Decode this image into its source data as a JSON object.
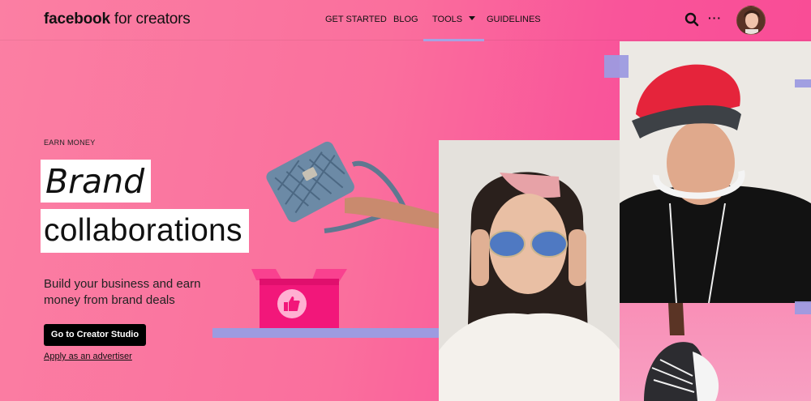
{
  "header": {
    "logo_bold": "facebook",
    "logo_rest": " for creators",
    "nav": [
      {
        "label": "GET STARTED"
      },
      {
        "label": "BLOG"
      },
      {
        "label": "TOOLS"
      },
      {
        "label": "GUIDELINES"
      }
    ],
    "more_label": "···"
  },
  "hero": {
    "eyebrow": "EARN MONEY",
    "title_line1": "Brand",
    "title_line2": "collaborations",
    "description": "Build your business and earn money from brand deals",
    "cta_label": "Go to Creator Studio",
    "link_label": "Apply as an advertiser"
  },
  "colors": {
    "background": "#fa6f9d",
    "accent": "#9d9be0",
    "box": "#f2177a",
    "cta_bg": "#000000"
  },
  "icons": [
    "search-icon",
    "more-icon",
    "thumbs-up-icon"
  ]
}
